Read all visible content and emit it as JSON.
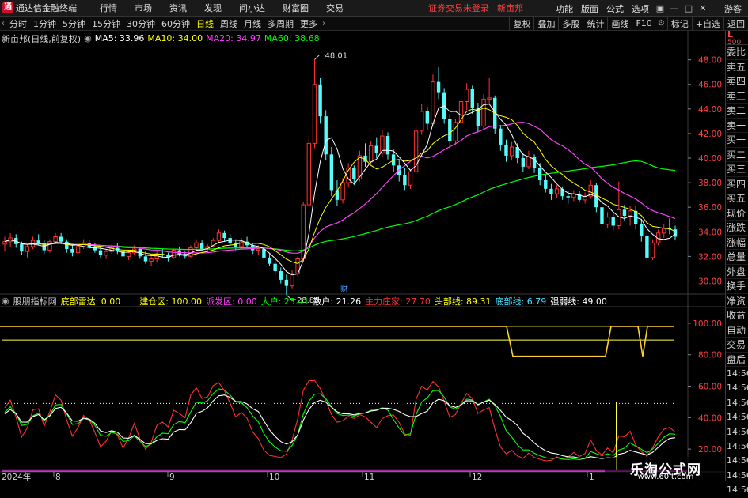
{
  "menubar": {
    "app_title": "通达信金融终端",
    "items": [
      "行情",
      "市场",
      "资讯",
      "发现",
      "问小达",
      "财富圈",
      "交易"
    ],
    "warning": "证券交易未登录",
    "stock_name": "新亩邦",
    "right_items": [
      "功能",
      "版面",
      "公式",
      "选项"
    ],
    "guest": "游客"
  },
  "toolbar": {
    "periods": [
      "分时",
      "1分钟",
      "5分钟",
      "15分钟",
      "30分钟",
      "60分钟",
      "日线",
      "周线",
      "月线",
      "多周期",
      "更多"
    ],
    "active_period": "日线",
    "right_buttons": [
      "复权",
      "叠加",
      "多股",
      "统计",
      "画线",
      "F10",
      "标记",
      "+自选",
      "返回"
    ]
  },
  "main_legend": {
    "title": "新亩邦(日线,前复权)",
    "ma5": "MA5: 33.96",
    "ma10": "MA10: 34.00",
    "ma20": "MA20: 34.97",
    "ma60": "MA60: 38.68",
    "colors": {
      "ma5": "#ffffff",
      "ma10": "#ffff00",
      "ma20": "#ff40ff",
      "ma60": "#00ff00"
    }
  },
  "main_chart": {
    "y_ticks": [
      "48.00",
      "46.00",
      "44.00",
      "42.00",
      "40.00",
      "38.00",
      "36.00",
      "34.00",
      "32.00",
      "30.00"
    ],
    "y_range": [
      29.0,
      49.2
    ],
    "high_label": "48.01",
    "low_label": "28.88",
    "event_marker": "财"
  },
  "indicator_legend": {
    "name": "股朋指标网",
    "bottom_radar": "底部雷达: 0.00",
    "build_zone": "建仓区: 100.00",
    "launch_zone": "派发区: 0.00",
    "big_holder": "大户: 23.41",
    "retail": "散户: 21.26",
    "main_force": "主力庄家: 27.70",
    "top_line": "头部线: 89.31",
    "bottom_line": "底部线: 6.79",
    "strength_line": "强弱线: 49.00",
    "colors": {
      "name": "#cccccc",
      "bottom_radar": "#ffff00",
      "build_zone": "#ffff00",
      "launch_zone": "#ff40ff",
      "big_holder": "#00ff00",
      "retail": "#ffffff",
      "main_force": "#ff3030",
      "top_line": "#ffff00",
      "bottom_line": "#40e0ff",
      "strength_line": "#ffffff"
    }
  },
  "indicator_chart": {
    "y_ticks": [
      "100.00",
      "80.00",
      "60.00",
      "40.00",
      "20.00"
    ],
    "y_range": [
      6,
      110
    ]
  },
  "x_axis": {
    "labels": [
      "2024年",
      "8",
      "9",
      "10",
      "11",
      "12",
      "1"
    ]
  },
  "right_panel": {
    "top_label": "L",
    "top_sub": "500",
    "items": [
      "委比",
      "卖五",
      "卖四",
      "卖三",
      "卖二",
      "卖一",
      "买一",
      "买二",
      "买三",
      "买四",
      "买五",
      "现价",
      "涨跌",
      "涨幅",
      "总量",
      "外盘",
      "换手",
      "净资",
      "收益",
      "自动",
      "交易",
      "盘后"
    ],
    "times": [
      "14:56",
      "14:56",
      "14:56",
      "14:56",
      "14:56",
      "14:56",
      "14:56",
      "14:56",
      "14:56"
    ]
  },
  "watermark": {
    "line1": "乐淘公式网",
    "line2": "www.60lt.com"
  },
  "chart_data": {
    "type": "candlestick",
    "title": "新亩邦(日线,前复权)",
    "y_range": [
      29.0,
      49.2
    ],
    "high": 48.01,
    "low": 28.88,
    "ohlc": [
      [
        33.0,
        33.6,
        32.4,
        33.2
      ],
      [
        33.2,
        33.9,
        32.8,
        33.5
      ],
      [
        33.5,
        33.8,
        32.7,
        33.0
      ],
      [
        33.0,
        33.2,
        32.1,
        32.4
      ],
      [
        32.4,
        33.0,
        31.9,
        32.8
      ],
      [
        32.8,
        33.6,
        32.6,
        33.3
      ],
      [
        33.3,
        33.8,
        32.9,
        33.1
      ],
      [
        33.1,
        33.3,
        32.2,
        32.5
      ],
      [
        32.5,
        33.4,
        32.3,
        33.2
      ],
      [
        33.2,
        33.9,
        33.0,
        33.6
      ],
      [
        33.6,
        33.9,
        33.0,
        33.2
      ],
      [
        33.2,
        33.4,
        32.3,
        32.6
      ],
      [
        32.6,
        32.9,
        32.0,
        32.3
      ],
      [
        32.3,
        33.0,
        32.1,
        32.8
      ],
      [
        32.8,
        33.4,
        32.6,
        33.1
      ],
      [
        33.1,
        33.3,
        32.6,
        32.8
      ],
      [
        32.8,
        33.1,
        32.3,
        32.5
      ],
      [
        32.5,
        32.8,
        31.9,
        32.1
      ],
      [
        32.1,
        32.6,
        31.8,
        32.4
      ],
      [
        32.4,
        33.0,
        32.2,
        32.7
      ],
      [
        32.7,
        33.1,
        32.2,
        32.4
      ],
      [
        32.4,
        32.6,
        31.8,
        32.0
      ],
      [
        32.0,
        32.5,
        31.7,
        32.3
      ],
      [
        32.3,
        32.9,
        32.1,
        32.6
      ],
      [
        32.6,
        32.8,
        31.8,
        32.0
      ],
      [
        32.0,
        32.4,
        31.4,
        31.6
      ],
      [
        31.6,
        32.0,
        31.2,
        31.8
      ],
      [
        31.8,
        32.4,
        31.5,
        32.2
      ],
      [
        32.2,
        32.6,
        31.9,
        32.1
      ],
      [
        32.1,
        32.3,
        31.6,
        31.9
      ],
      [
        31.9,
        32.6,
        31.8,
        32.5
      ],
      [
        32.5,
        32.8,
        32.0,
        32.2
      ],
      [
        32.2,
        32.4,
        31.8,
        32.0
      ],
      [
        32.0,
        32.9,
        31.9,
        32.7
      ],
      [
        32.7,
        33.4,
        32.5,
        33.1
      ],
      [
        33.1,
        33.3,
        32.4,
        32.6
      ],
      [
        32.6,
        33.0,
        32.3,
        32.8
      ],
      [
        32.8,
        33.5,
        32.7,
        33.3
      ],
      [
        33.3,
        34.2,
        33.1,
        33.9
      ],
      [
        33.9,
        34.1,
        33.2,
        33.5
      ],
      [
        33.5,
        33.8,
        32.9,
        33.1
      ],
      [
        33.1,
        33.4,
        32.5,
        32.8
      ],
      [
        32.8,
        33.5,
        32.6,
        33.2
      ],
      [
        33.2,
        33.6,
        32.7,
        32.9
      ],
      [
        32.9,
        33.1,
        32.2,
        32.5
      ],
      [
        32.5,
        32.9,
        32.1,
        32.6
      ],
      [
        32.6,
        32.8,
        31.7,
        31.9
      ],
      [
        31.9,
        32.2,
        31.2,
        31.4
      ],
      [
        31.4,
        31.8,
        30.5,
        30.8
      ],
      [
        30.8,
        31.1,
        29.8,
        30.1
      ],
      [
        30.1,
        30.6,
        28.88,
        29.6
      ],
      [
        29.6,
        30.9,
        29.4,
        30.6
      ],
      [
        30.6,
        32.0,
        30.4,
        31.8
      ],
      [
        31.8,
        36.4,
        31.6,
        36.2
      ],
      [
        36.2,
        41.8,
        36.0,
        41.2
      ],
      [
        41.2,
        48.01,
        40.8,
        46.0
      ],
      [
        46.0,
        46.5,
        42.8,
        43.4
      ],
      [
        43.4,
        43.9,
        39.8,
        40.3
      ],
      [
        40.3,
        40.9,
        36.9,
        37.4
      ],
      [
        37.4,
        38.2,
        36.1,
        36.6
      ],
      [
        36.6,
        38.4,
        36.3,
        38.0
      ],
      [
        38.0,
        39.6,
        37.6,
        39.2
      ],
      [
        39.2,
        39.4,
        37.8,
        38.3
      ],
      [
        38.3,
        40.6,
        38.1,
        40.2
      ],
      [
        40.2,
        41.2,
        39.3,
        39.7
      ],
      [
        39.7,
        41.4,
        39.5,
        41.0
      ],
      [
        41.0,
        41.7,
        40.0,
        40.4
      ],
      [
        40.4,
        42.3,
        40.1,
        41.8
      ],
      [
        41.8,
        42.1,
        39.9,
        40.3
      ],
      [
        40.3,
        40.7,
        38.9,
        39.4
      ],
      [
        39.4,
        39.9,
        38.1,
        38.6
      ],
      [
        38.6,
        39.2,
        37.4,
        37.8
      ],
      [
        37.8,
        39.1,
        37.5,
        38.9
      ],
      [
        38.9,
        42.6,
        38.7,
        42.2
      ],
      [
        42.2,
        44.4,
        41.9,
        43.8
      ],
      [
        43.8,
        44.2,
        42.3,
        42.8
      ],
      [
        42.8,
        46.8,
        42.6,
        46.2
      ],
      [
        46.2,
        47.4,
        44.8,
        45.3
      ],
      [
        45.3,
        45.7,
        42.8,
        43.2
      ],
      [
        43.2,
        43.6,
        40.8,
        41.4
      ],
      [
        41.4,
        43.2,
        41.1,
        42.9
      ],
      [
        42.9,
        45.1,
        42.6,
        44.6
      ],
      [
        44.6,
        46.1,
        43.9,
        45.6
      ],
      [
        45.6,
        45.9,
        43.6,
        44.1
      ],
      [
        44.1,
        44.5,
        42.1,
        42.6
      ],
      [
        42.6,
        45.2,
        42.3,
        44.8
      ],
      [
        44.8,
        46.5,
        44.4,
        44.9
      ],
      [
        44.9,
        45.1,
        42.0,
        42.4
      ],
      [
        42.4,
        42.7,
        40.6,
        41.1
      ],
      [
        41.1,
        41.5,
        39.7,
        40.2
      ],
      [
        40.2,
        41.3,
        39.8,
        40.9
      ],
      [
        40.9,
        41.2,
        39.6,
        40.0
      ],
      [
        40.0,
        40.4,
        38.9,
        39.3
      ],
      [
        39.3,
        40.6,
        39.1,
        40.1
      ],
      [
        40.1,
        40.3,
        38.8,
        39.2
      ],
      [
        39.2,
        39.6,
        37.8,
        38.2
      ],
      [
        38.2,
        38.7,
        37.2,
        37.5
      ],
      [
        37.5,
        37.9,
        36.6,
        37.1
      ],
      [
        37.1,
        37.8,
        36.8,
        37.5
      ],
      [
        37.5,
        37.7,
        36.6,
        36.9
      ],
      [
        36.9,
        37.3,
        36.3,
        36.8
      ],
      [
        36.8,
        37.4,
        36.5,
        37.1
      ],
      [
        37.1,
        37.3,
        36.4,
        36.6
      ],
      [
        36.6,
        37.2,
        36.3,
        36.9
      ],
      [
        36.9,
        38.2,
        36.7,
        37.8
      ],
      [
        37.8,
        38.0,
        35.6,
        36.0
      ],
      [
        36.0,
        36.4,
        34.2,
        34.6
      ],
      [
        34.6,
        35.6,
        34.3,
        35.2
      ],
      [
        35.2,
        35.6,
        34.1,
        34.5
      ],
      [
        34.5,
        38.1,
        34.2,
        35.8
      ],
      [
        35.8,
        36.2,
        34.9,
        35.3
      ],
      [
        35.3,
        36.1,
        34.5,
        35.7
      ],
      [
        35.7,
        36.1,
        34.2,
        34.6
      ],
      [
        34.6,
        35.0,
        33.2,
        33.7
      ],
      [
        33.7,
        34.0,
        31.5,
        31.9
      ],
      [
        31.9,
        33.4,
        31.7,
        33.1
      ],
      [
        33.1,
        34.2,
        32.9,
        33.9
      ],
      [
        33.9,
        34.6,
        33.5,
        34.3
      ],
      [
        34.3,
        35.1,
        33.8,
        34.2
      ],
      [
        34.2,
        34.5,
        33.3,
        33.6
      ]
    ]
  }
}
